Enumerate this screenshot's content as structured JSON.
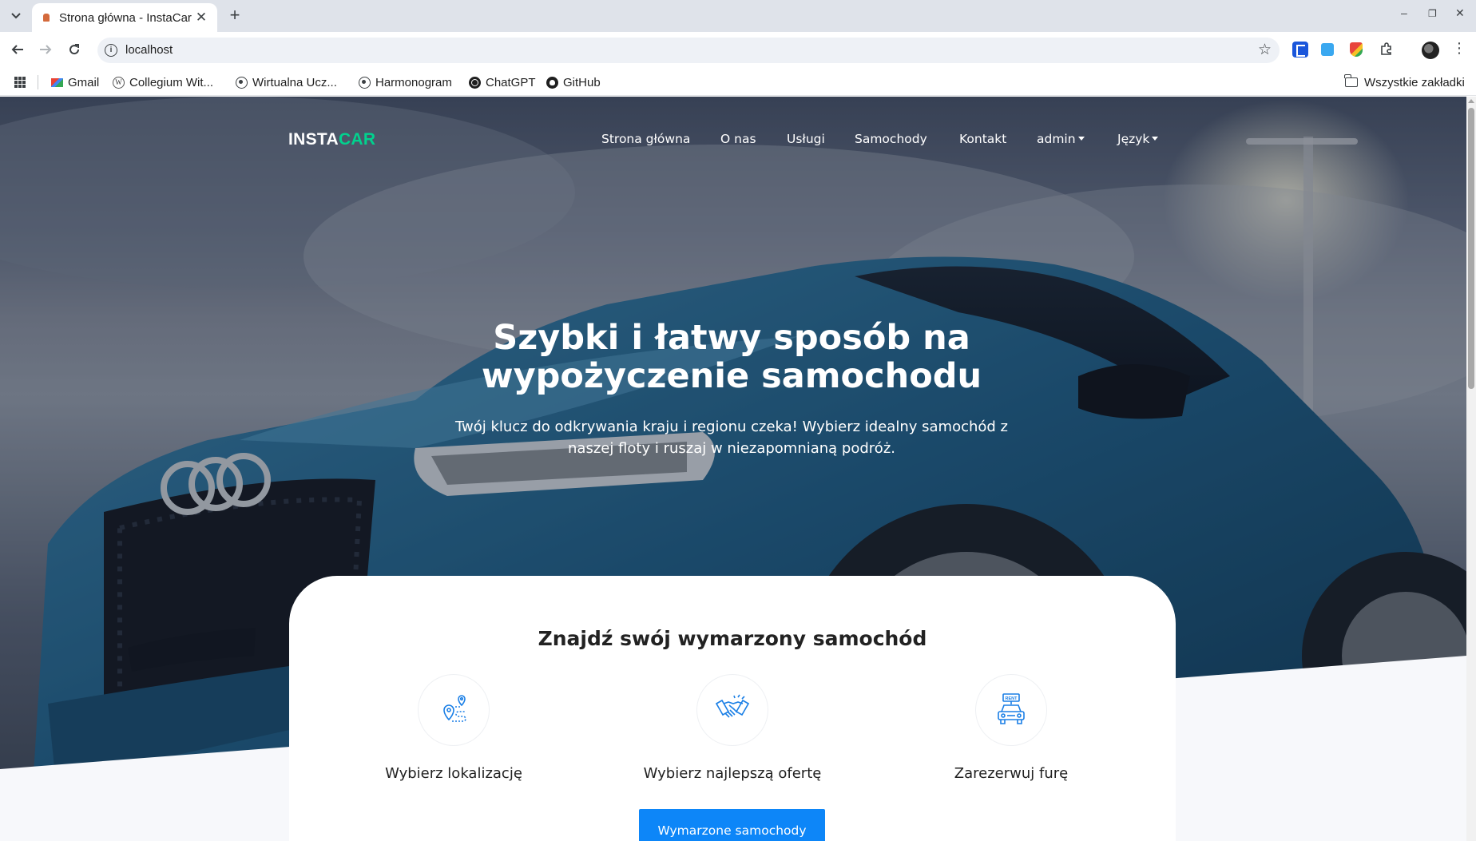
{
  "browser": {
    "tab_title": "Strona główna - InstaCar",
    "new_tab_symbol": "+",
    "close_symbol": "✕",
    "url": "localhost",
    "window_controls": [
      "–",
      "❐",
      "✕"
    ],
    "bookmarks": [
      {
        "label": "Gmail",
        "icon": "gmail-icon"
      },
      {
        "label": "Collegium Wit...",
        "icon": "wiki-icon"
      },
      {
        "label": "Wirtualna Ucz...",
        "icon": "globe-icon"
      },
      {
        "label": "Harmonogram",
        "icon": "globe-icon"
      },
      {
        "label": "ChatGPT",
        "icon": "chatgpt-icon"
      },
      {
        "label": "GitHub",
        "icon": "github-icon"
      }
    ],
    "all_bookmarks_label": "Wszystkie zakładki"
  },
  "site": {
    "brand_main": "INSTA",
    "brand_accent": "CAR",
    "accent_color": "#01d28e",
    "nav": {
      "home": "Strona główna",
      "about": "O nas",
      "services": "Usługi",
      "cars": "Samochody",
      "contact": "Kontakt",
      "user": "admin",
      "language": "Język"
    },
    "hero": {
      "title": "Szybki i łatwy sposób na wypożyczenie samochodu",
      "subtitle": "Twój klucz do odkrywania kraju i regionu czeka! Wybierz idealny samochód z naszej floty i ruszaj w niezapomnianą podróż."
    },
    "finder": {
      "title": "Znajdź swój wymarzony samochód",
      "features": [
        {
          "label": "Wybierz lokalizację",
          "icon": "location-route-icon"
        },
        {
          "label": "Wybierz najlepszą ofertę",
          "icon": "handshake-icon"
        },
        {
          "label": "Zarezerwuj furę",
          "icon": "rent-car-icon"
        }
      ],
      "cta_label": "Wymarzone samochody",
      "cta_color": "#0d86f8"
    }
  }
}
